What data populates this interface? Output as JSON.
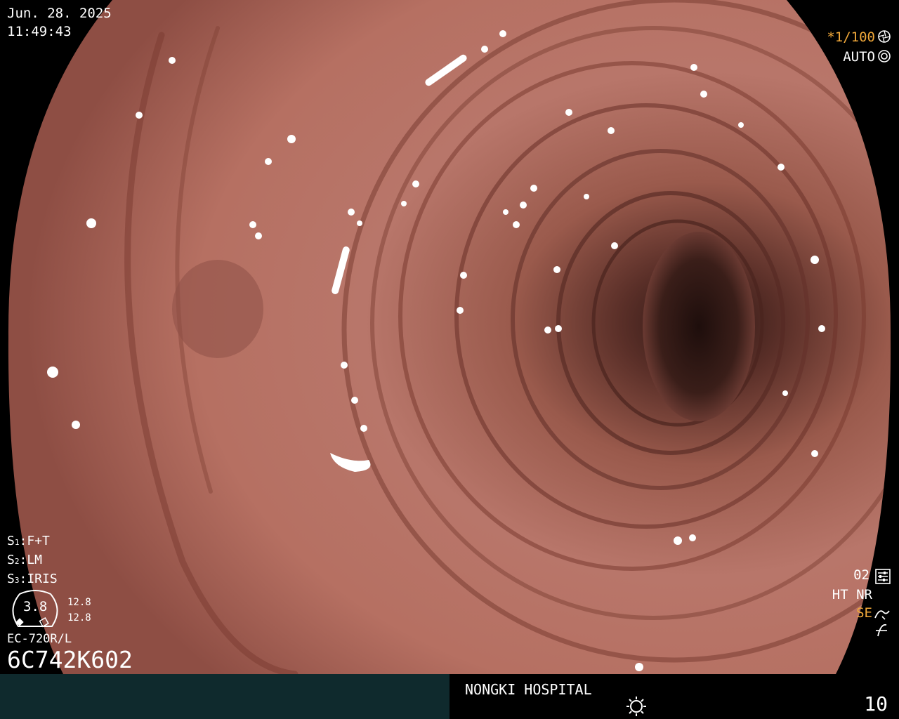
{
  "overlay": {
    "date": "Jun. 28. 2025",
    "time": "11:49:43",
    "shutter": "*1/100",
    "exposure_mode": "AUTO",
    "settings": [
      {
        "key": "S",
        "num": "1",
        "value": "F+T"
      },
      {
        "key": "S",
        "num": "2",
        "value": "LM"
      },
      {
        "key": "S",
        "num": "3",
        "value": "IRIS"
      }
    ],
    "gauge_value": "3.8",
    "gauge_sub1": "12.8",
    "gauge_sub2": "12.8",
    "scope_model": "EC-720R/L",
    "serial": "6C742K602",
    "setting_no": "02",
    "ht_nr": "HT NR",
    "se": "SE"
  },
  "footer": {
    "hospital": "NONGKI HOSPITAL",
    "counter": "10"
  },
  "icons": [
    "shutter-icon",
    "auto-exposure-icon",
    "config-icon",
    "se-icon",
    "no-flicker-icon",
    "lamp-icon"
  ],
  "colors": {
    "accent_orange": "#f2a93a",
    "footer_left": "#0f2a2d",
    "tissue": "#b06a5c"
  }
}
